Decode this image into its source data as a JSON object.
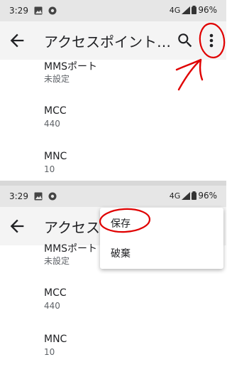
{
  "status_bar": {
    "time": "3:29",
    "network": "4G",
    "battery": "96%"
  },
  "app_bar": {
    "title": "アクセスポイント…",
    "title_partial": "アクセスポ"
  },
  "preferences": [
    {
      "title": "MMSポート",
      "summary": "未設定"
    },
    {
      "title": "MCC",
      "summary": "440"
    },
    {
      "title": "MNC",
      "summary": "10"
    }
  ],
  "overflow_menu": {
    "items": [
      {
        "label": "保存"
      },
      {
        "label": "破棄"
      }
    ]
  },
  "colors": {
    "annotation": "#e00000",
    "status_bar": "#e6e6e6",
    "app_bar": "#f4f4f4"
  },
  "icons": [
    "back-arrow-icon",
    "search-icon",
    "more-vert-icon",
    "image-icon",
    "chrome-icon",
    "signal-icon",
    "battery-icon"
  ]
}
